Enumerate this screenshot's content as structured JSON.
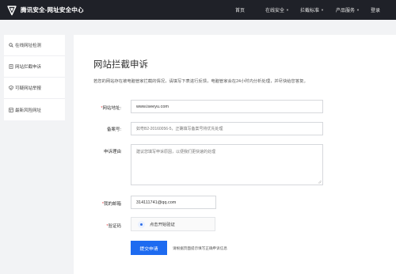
{
  "header": {
    "brand": "腾讯安全-网址安全中心",
    "nav": [
      {
        "label": "首页",
        "has_dropdown": false
      },
      {
        "label": "在线安全",
        "has_dropdown": true
      },
      {
        "label": "拦截标准",
        "has_dropdown": true
      },
      {
        "label": "产品服务",
        "has_dropdown": true
      },
      {
        "label": "登录",
        "has_dropdown": false
      }
    ]
  },
  "sidebar": {
    "items": [
      {
        "label": "在线网址检测",
        "icon": "search-icon"
      },
      {
        "label": "网站拦截申诉",
        "icon": "document-icon"
      },
      {
        "label": "可疑网站举报",
        "icon": "shield-icon"
      },
      {
        "label": "最新风险网址",
        "icon": "list-icon"
      }
    ]
  },
  "main": {
    "title": "网站拦截申诉",
    "description": "若您的网站存在被电脑管家拦截的情况，请填写下表进行反馈，电脑管家会在24小时内分析处理，并尽快给您答复。",
    "form": {
      "url_label": "网站地址:",
      "url_value": "www.iseeyu.com",
      "icp_label": "备案号:",
      "icp_placeholder": "如粤B2-20160056-5，正确填写备案号将优先处理",
      "reason_label": "申诉理由",
      "reason_placeholder": "建议您填写申诉原因，以便我们更快速的处理",
      "email_label": "我的邮箱",
      "email_value": "314111741@qq.com",
      "captcha_label": "验证码",
      "captcha_text": "点击开始验证",
      "submit_label": "提交申请",
      "hint": "请根据页面提示填写正确申诉信息"
    }
  },
  "colors": {
    "topbar": "#1f2128",
    "primary": "#1e6bf0",
    "required": "#e2393b"
  }
}
